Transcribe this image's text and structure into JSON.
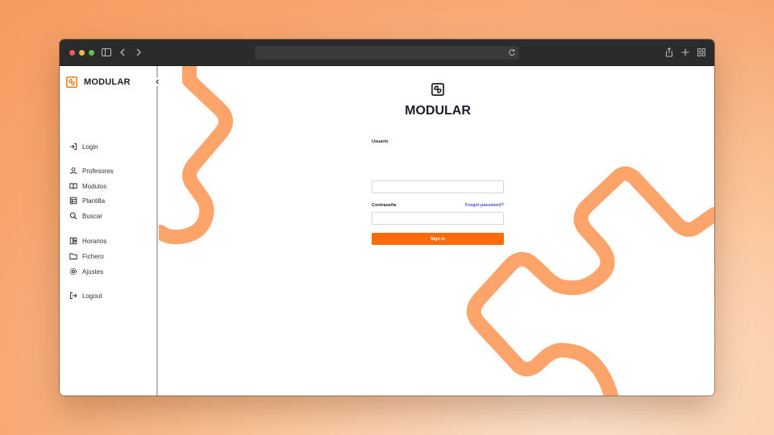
{
  "app": {
    "brand_name": "MODULAR",
    "accent_color": "#fb6a0b",
    "decoration_color": "#fda46b"
  },
  "browser": {
    "icons": [
      "sidebar-toggle-icon",
      "back-icon",
      "forward-icon",
      "reload-icon",
      "share-icon",
      "new-tab-icon",
      "tab-overview-icon"
    ]
  },
  "sidebar": {
    "items": [
      {
        "label": "Login",
        "icon": "login-icon"
      },
      {
        "label": "Profesores",
        "icon": "user-icon"
      },
      {
        "label": "Modulos",
        "icon": "book-icon"
      },
      {
        "label": "Plantilla",
        "icon": "template-icon"
      },
      {
        "label": "Buscar",
        "icon": "search-icon"
      },
      {
        "label": "Horarios",
        "icon": "schedule-icon"
      },
      {
        "label": "Fichero",
        "icon": "folder-icon"
      },
      {
        "label": "Ajustes",
        "icon": "settings-icon"
      },
      {
        "label": "Logout",
        "icon": "logout-icon"
      }
    ]
  },
  "login": {
    "title": "MODULAR",
    "username_label": "Usuario",
    "username_value": "",
    "password_label": "Contraseña",
    "password_value": "",
    "forgot_label": "Forgot password?",
    "submit_label": "Sign in"
  }
}
